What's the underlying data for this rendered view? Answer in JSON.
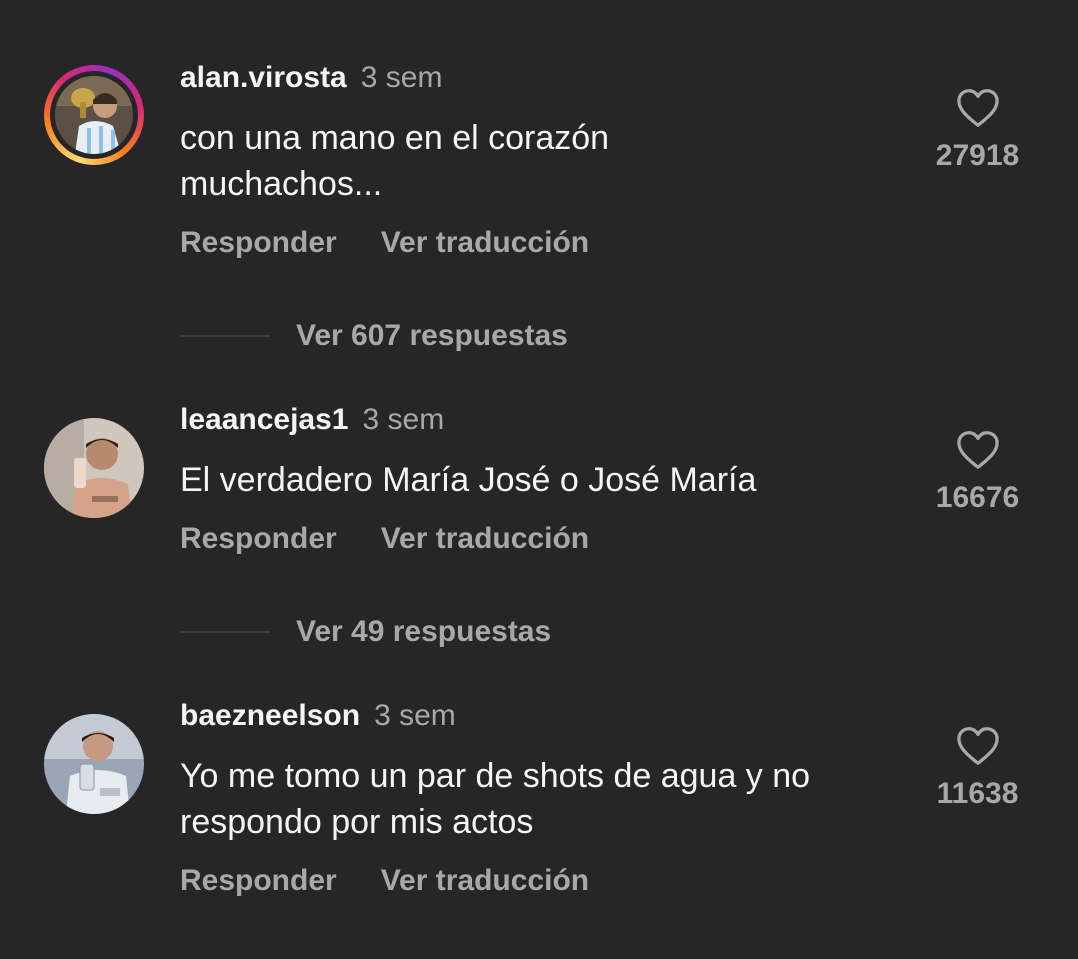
{
  "comments": [
    {
      "username": "alan.virosta",
      "time": "3 sem",
      "text": "con una mano en el corazón muchachos...",
      "likes": "27918",
      "reply_label": "Responder",
      "translate_label": "Ver traducción",
      "has_story_ring": true,
      "view_replies": "Ver 607 respuestas"
    },
    {
      "username": "leaancejas1",
      "time": "3 sem",
      "text": "El verdadero María José o José María",
      "likes": "16676",
      "reply_label": "Responder",
      "translate_label": "Ver traducción",
      "has_story_ring": false,
      "view_replies": "Ver 49 respuestas"
    },
    {
      "username": "baezneelson",
      "time": "3 sem",
      "text": "Yo me tomo un par de shots de agua y no respondo por mis actos",
      "likes": "11638",
      "reply_label": "Responder",
      "translate_label": "Ver traducción",
      "has_story_ring": false
    }
  ],
  "icons": {
    "like": "heart-outline-icon"
  },
  "colors": {
    "background": "#262626",
    "primary_text": "#f5f5f5",
    "secondary_text": "#a8a8a8",
    "divider": "#3d3d3d"
  }
}
